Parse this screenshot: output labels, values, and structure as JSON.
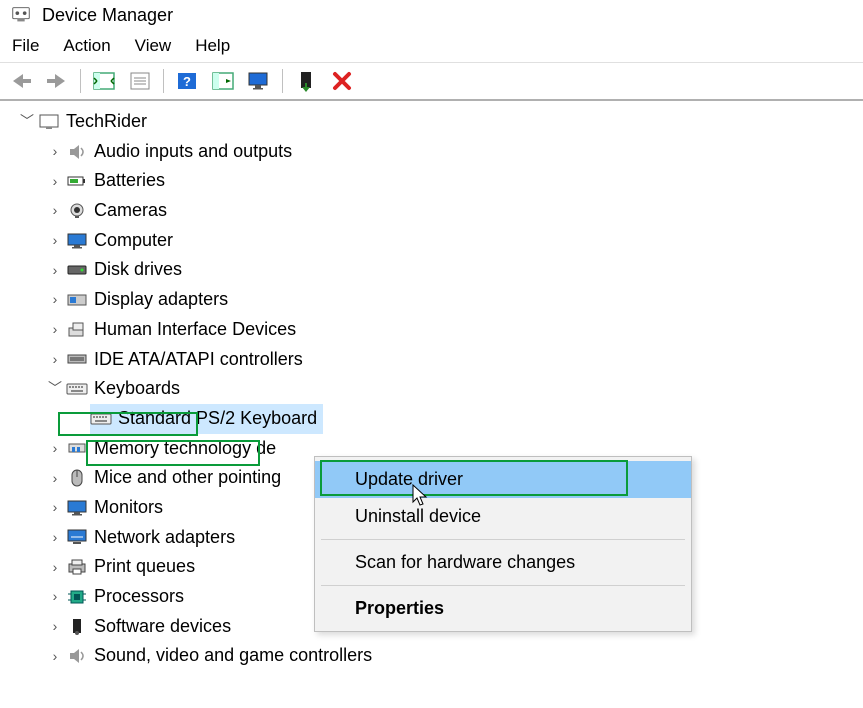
{
  "window": {
    "title": "Device Manager"
  },
  "menu": {
    "file": "File",
    "action": "Action",
    "view": "View",
    "help": "Help"
  },
  "tree": {
    "root": "TechRider",
    "nodes": {
      "audio": "Audio inputs and outputs",
      "batteries": "Batteries",
      "cameras": "Cameras",
      "computer": "Computer",
      "disk": "Disk drives",
      "display": "Display adapters",
      "hid": "Human Interface Devices",
      "ide": "IDE ATA/ATAPI controllers",
      "keyboards": "Keyboards",
      "keyboard_device": "Standard PS/2 Keyboard",
      "memtech": "Memory technology de",
      "mice": "Mice and other pointing",
      "monitors": "Monitors",
      "network": "Network adapters",
      "printq": "Print queues",
      "processors": "Processors",
      "software": "Software devices",
      "sound": "Sound, video and game controllers"
    }
  },
  "context_menu": {
    "update": "Update driver",
    "uninstall": "Uninstall device",
    "scan": "Scan for hardware changes",
    "properties": "Properties"
  }
}
